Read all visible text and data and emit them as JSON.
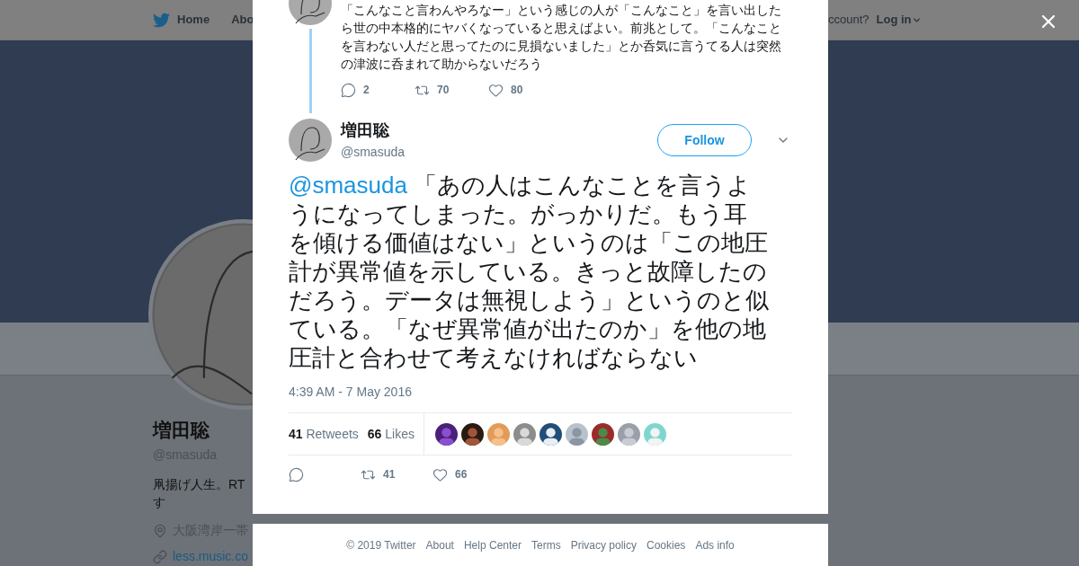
{
  "nav": {
    "items": [
      "Home",
      "Abo"
    ],
    "account_prompt": "ccount?",
    "login": "Log in"
  },
  "profile": {
    "name": "増田聡",
    "handle": "@smasuda",
    "bio_lines": [
      "凧揚げ人生。RT",
      "す"
    ],
    "location": "大阪湾岸一帯",
    "link": "less.music.co"
  },
  "previous_tweet": {
    "text": "「こんなこと言わんやろなー」という感じの人が「こんなこと」を言い出したら世の中本格的にヤバくなっていると思えばよい。前兆として。「こんなことを言わない人だと思ってたのに見損ないました」とか呑気に言うてる人は突然の津波に呑まれて助からないだろう",
    "replies": "2",
    "retweets": "70",
    "likes": "80"
  },
  "tweet": {
    "name": "増田聡",
    "handle": "@smasuda",
    "follow_label": "Follow",
    "mention": "@smasuda",
    "text": "「あの人はこんなことを言うようになってしまった。がっかりだ。もう耳を傾ける価値はない」というのは「この地圧計が異常値を示している。きっと故障したのだろう。データは無視しよう」というのと似ている。「なぜ異常値が出たのか」を他の地圧計と合わせて考えなければならない",
    "timestamp": "4:39 AM - 7 May 2016",
    "retweet_count": "41",
    "retweet_label": "Retweets",
    "like_count": "66",
    "like_label": "Likes",
    "action_retweets": "41",
    "action_likes": "66"
  },
  "footer": [
    "© 2019 Twitter",
    "About",
    "Help Center",
    "Terms",
    "Privacy policy",
    "Cookies",
    "Ads info"
  ]
}
